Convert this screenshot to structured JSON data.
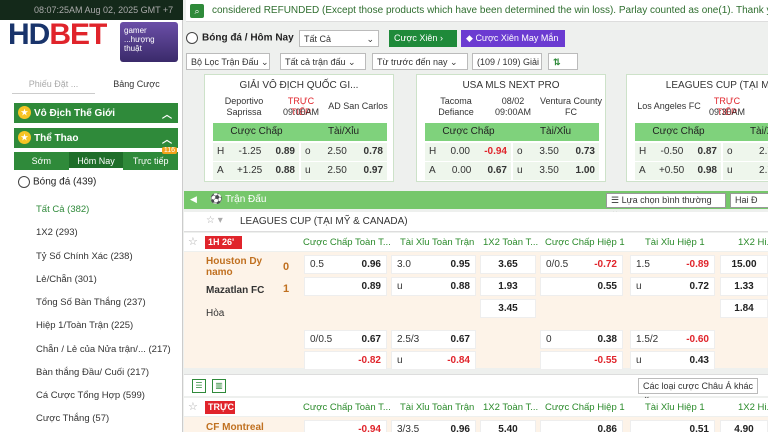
{
  "topbar": {
    "time": "08:07:25AM Aug 02, 2025 GMT +7"
  },
  "logo": {
    "part1": "HD",
    "part2": "BET"
  },
  "promo": {
    "text": "gamer ...hượng thuật"
  },
  "left_tabs": [
    "Phiếu Đặt ...",
    "Bảng Cược"
  ],
  "left_sections": {
    "world_cup": "Vô Địch Thế Giới",
    "sports": "Thể Thao"
  },
  "sub_tabs": [
    "Sớm",
    "Hôm Nay",
    "Trực tiếp"
  ],
  "live_count": "116",
  "sport": {
    "name": "Bóng đá",
    "count": "(439)"
  },
  "menu": [
    {
      "label": "Tất Cả",
      "count": "(382)"
    },
    {
      "label": "1X2",
      "count": "(293)"
    },
    {
      "label": "Tỷ Số Chính Xác",
      "count": "(238)"
    },
    {
      "label": "Lẻ/Chẵn",
      "count": "(301)"
    },
    {
      "label": "Tổng Số Bàn Thắng",
      "count": "(237)"
    },
    {
      "label": "Hiệp 1/Toàn Trận",
      "count": "(225)"
    },
    {
      "label": "Chẵn / Lẻ của Nửa trận/...",
      "count": "(217)"
    },
    {
      "label": "Bàn thắng Đầu/ Cuối",
      "count": "(217)"
    },
    {
      "label": "Cá Cược Tổng Hợp",
      "count": "(599)"
    },
    {
      "label": "Cược Thắng",
      "count": "(57)"
    }
  ],
  "notice": "considered REFUNDED (Except those products which have been determined the win loss). Parlay counted as one(1). Thank you!",
  "breadcrumb": "Bóng đá / Hôm Nay",
  "select_all": "Tất Cả",
  "btn_parlay": "Cược Xiên",
  "btn_parlay_random": "Cược Xiên May Mắn",
  "filters": {
    "match_filter": "Bộ Lọc Trận Đấu",
    "all_matches": "Tất cả trận đấu",
    "from_before": "Từ trước đến nay",
    "count": "(109 / 109) Giải"
  },
  "cards": [
    {
      "league": "GIẢI VÔ ĐỊCH QUỐC GI...",
      "home": "Deportivo Saprissa",
      "status": "TRỰC TIẾP",
      "time": "09:00AM",
      "away": "AD San Carlos",
      "h1": "Cược Chấp",
      "h2": "Tài/Xỉu",
      "r1": [
        "H",
        "-1.25",
        "0.89",
        "o",
        "2.50",
        "0.78"
      ],
      "r2": [
        "A",
        "+1.25",
        "0.88",
        "u",
        "2.50",
        "0.97"
      ]
    },
    {
      "league": "USA MLS NEXT PRO",
      "home": "Tacoma Defiance",
      "status": "08/02",
      "time": "09:00AM",
      "away": "Ventura County FC",
      "h1": "Cược Chấp",
      "h2": "Tài/Xỉu",
      "r1": [
        "H",
        "0.00",
        "-0.94",
        "o",
        "3.50",
        "0.73"
      ],
      "r2": [
        "A",
        "0.00",
        "0.67",
        "u",
        "3.50",
        "1.00"
      ]
    },
    {
      "league": "LEAGUES CUP (TẠI MỸ",
      "home": "Los Angeles FC",
      "status": "TRỰC TIẾP",
      "time": "09:30AM",
      "away": "",
      "h1": "Cược Chấp",
      "h2": "Tài/Xỉu",
      "r1": [
        "H",
        "-0.50",
        "0.87",
        "o",
        "2.75",
        ""
      ],
      "r2": [
        "A",
        "+0.50",
        "0.98",
        "u",
        "2.75",
        ""
      ]
    }
  ],
  "table": {
    "title": "Trận Đấu",
    "odds_type": "Lựa chọn bình thường",
    "half": "Hai Đ",
    "league": "LEAGUES CUP (TẠI MỸ & CANADA)"
  },
  "col_headers": [
    "Cược Chấp Toàn T...",
    "Tài Xỉu Toàn Trận",
    "1X2 Toàn T...",
    "Cược Chấp Hiệp 1",
    "Tài Xỉu Hiệp 1",
    "1X2 Hi..."
  ],
  "match1": {
    "badge": "1H 26'",
    "home": "Houston Dy namo",
    "away": "Mazatlan FC",
    "home_score": "0",
    "away_score": "1",
    "draw": "Hòa",
    "row1": {
      "hc_line": "0.5",
      "hc_odd": "0.96",
      "ou_line": "3.0",
      "ou_odd": "0.95",
      "x12": "3.65",
      "h1_line": "0/0.5",
      "h1_odd": "-0.72",
      "ou1_line": "1.5",
      "ou1_odd": "-0.89",
      "x12h": "15.00"
    },
    "row2": {
      "hc_odd": "0.89",
      "ou_side": "u",
      "ou_odd": "0.88",
      "x12": "1.93",
      "h1_odd": "0.55",
      "ou1_side": "u",
      "ou1_odd": "0.72",
      "x12h": "1.33"
    },
    "row3": {
      "x12": "3.45",
      "x12h": "1.84"
    },
    "row4": {
      "hc_line": "0/0.5",
      "hc_odd": "0.67",
      "ou_line": "2.5/3",
      "ou_odd": "0.67",
      "h1_line": "0",
      "h1_odd": "0.38",
      "ou1_line": "1.5/2",
      "ou1_odd": "-0.60"
    },
    "row5": {
      "hc_odd": "-0.82",
      "ou_side": "u",
      "ou_odd": "-0.84",
      "h1_odd": "-0.55",
      "ou1_side": "u",
      "ou1_odd": "0.43"
    }
  },
  "asian_select": "Các loại cược Châu Á khác",
  "match2": {
    "badge": "TRỰC",
    "home": "CF Montreal",
    "row": {
      "hc_odd": "-0.94",
      "ou_line": "3/3.5",
      "ou_odd": "0.96",
      "x12": "5.40",
      "h1_odd": "0.86",
      "ou1_odd": "0.51",
      "x12h": "4.90"
    }
  },
  "colors": {
    "green": "#2f8a3a",
    "light_green": "#76c76b",
    "red": "#e0242b",
    "purple": "#6b3bd1"
  }
}
